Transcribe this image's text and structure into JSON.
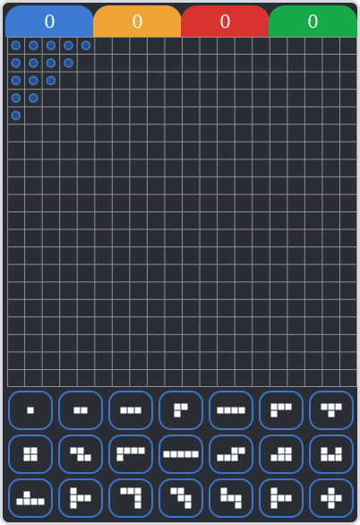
{
  "scores": [
    {
      "player": "blue",
      "value": "0",
      "color": "#3c7bd4"
    },
    {
      "player": "orange",
      "value": "0",
      "color": "#f0a436"
    },
    {
      "player": "red",
      "value": "0",
      "color": "#d93432"
    },
    {
      "player": "green",
      "value": "0",
      "color": "#18a94a"
    }
  ],
  "board": {
    "rows": 20,
    "cols": 20,
    "background": "#2a2d33",
    "grid_color": "#8d9096",
    "marker_color": "#3c7bd4",
    "markers": [
      [
        0,
        0
      ],
      [
        0,
        1
      ],
      [
        0,
        2
      ],
      [
        0,
        3
      ],
      [
        0,
        4
      ],
      [
        1,
        0
      ],
      [
        1,
        1
      ],
      [
        1,
        2
      ],
      [
        1,
        3
      ],
      [
        2,
        0
      ],
      [
        2,
        1
      ],
      [
        2,
        2
      ],
      [
        3,
        0
      ],
      [
        3,
        1
      ],
      [
        4,
        0
      ]
    ]
  },
  "pieces": {
    "border_color": "#3a74cc",
    "cell_color": "#ffffff",
    "items": [
      {
        "name": "monomino",
        "cells": [
          [
            0,
            0
          ]
        ]
      },
      {
        "name": "domino",
        "cells": [
          [
            0,
            0
          ],
          [
            0,
            1
          ]
        ]
      },
      {
        "name": "tromino-i",
        "cells": [
          [
            0,
            0
          ],
          [
            0,
            1
          ],
          [
            0,
            2
          ]
        ]
      },
      {
        "name": "tromino-l",
        "cells": [
          [
            0,
            0
          ],
          [
            0,
            1
          ],
          [
            1,
            0
          ]
        ]
      },
      {
        "name": "tetromino-i",
        "cells": [
          [
            0,
            0
          ],
          [
            0,
            1
          ],
          [
            0,
            2
          ],
          [
            0,
            3
          ]
        ]
      },
      {
        "name": "tetromino-l",
        "cells": [
          [
            0,
            0
          ],
          [
            0,
            1
          ],
          [
            0,
            2
          ],
          [
            1,
            0
          ]
        ]
      },
      {
        "name": "tetromino-t",
        "cells": [
          [
            0,
            0
          ],
          [
            0,
            1
          ],
          [
            0,
            2
          ],
          [
            1,
            1
          ]
        ]
      },
      {
        "name": "tetromino-o",
        "cells": [
          [
            0,
            0
          ],
          [
            0,
            1
          ],
          [
            1,
            0
          ],
          [
            1,
            1
          ]
        ]
      },
      {
        "name": "tetromino-z",
        "cells": [
          [
            0,
            0
          ],
          [
            0,
            1
          ],
          [
            1,
            1
          ],
          [
            1,
            2
          ]
        ]
      },
      {
        "name": "pentomino-l",
        "cells": [
          [
            0,
            0
          ],
          [
            0,
            1
          ],
          [
            0,
            2
          ],
          [
            0,
            3
          ],
          [
            1,
            0
          ]
        ]
      },
      {
        "name": "pentomino-i",
        "cells": [
          [
            0,
            0
          ],
          [
            0,
            1
          ],
          [
            0,
            2
          ],
          [
            0,
            3
          ],
          [
            0,
            4
          ]
        ]
      },
      {
        "name": "pentomino-n",
        "cells": [
          [
            0,
            2
          ],
          [
            0,
            3
          ],
          [
            1,
            0
          ],
          [
            1,
            1
          ],
          [
            1,
            2
          ]
        ]
      },
      {
        "name": "pentomino-p",
        "cells": [
          [
            0,
            1
          ],
          [
            0,
            2
          ],
          [
            1,
            0
          ],
          [
            1,
            1
          ],
          [
            1,
            2
          ]
        ]
      },
      {
        "name": "pentomino-u",
        "cells": [
          [
            0,
            0
          ],
          [
            0,
            2
          ],
          [
            1,
            0
          ],
          [
            1,
            1
          ],
          [
            1,
            2
          ]
        ]
      },
      {
        "name": "pentomino-y",
        "cells": [
          [
            0,
            1
          ],
          [
            1,
            0
          ],
          [
            1,
            1
          ],
          [
            1,
            2
          ],
          [
            1,
            3
          ]
        ]
      },
      {
        "name": "pentomino-f",
        "cells": [
          [
            0,
            0
          ],
          [
            1,
            0
          ],
          [
            1,
            1
          ],
          [
            1,
            2
          ],
          [
            2,
            0
          ]
        ]
      },
      {
        "name": "pentomino-v",
        "cells": [
          [
            0,
            0
          ],
          [
            0,
            1
          ],
          [
            0,
            2
          ],
          [
            1,
            2
          ],
          [
            2,
            2
          ]
        ]
      },
      {
        "name": "pentomino-w",
        "cells": [
          [
            0,
            0
          ],
          [
            0,
            1
          ],
          [
            1,
            1
          ],
          [
            1,
            2
          ],
          [
            2,
            2
          ]
        ]
      },
      {
        "name": "pentomino-z",
        "cells": [
          [
            0,
            0
          ],
          [
            1,
            0
          ],
          [
            1,
            1
          ],
          [
            1,
            2
          ],
          [
            2,
            2
          ]
        ]
      },
      {
        "name": "pentomino-t",
        "cells": [
          [
            0,
            0
          ],
          [
            1,
            0
          ],
          [
            1,
            1
          ],
          [
            1,
            2
          ],
          [
            2,
            0
          ]
        ]
      },
      {
        "name": "pentomino-x",
        "cells": [
          [
            0,
            1
          ],
          [
            1,
            0
          ],
          [
            1,
            1
          ],
          [
            1,
            2
          ],
          [
            2,
            1
          ]
        ]
      }
    ]
  }
}
